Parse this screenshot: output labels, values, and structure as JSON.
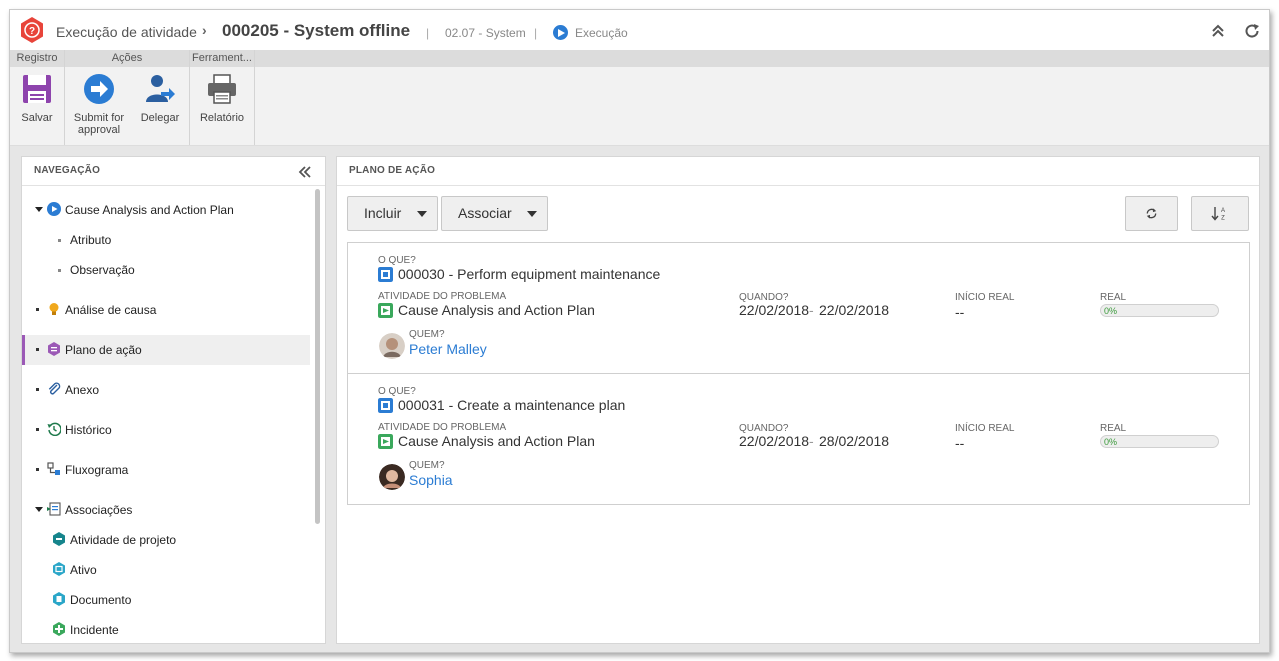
{
  "header": {
    "app_name": "Execução de atividade",
    "record_title": "000205 - System offline",
    "category": "02.07 - System",
    "status": "Execução"
  },
  "ribbon": {
    "groups": [
      "Registro",
      "Ações",
      "Ferrament..."
    ],
    "buttons": {
      "save": "Salvar",
      "submit_line1": "Submit for",
      "submit_line2": "approval",
      "delegate": "Delegar",
      "report": "Relatório"
    }
  },
  "navigation": {
    "title": "NAVEGAÇÃO",
    "items": [
      {
        "label": "Cause Analysis and Action Plan"
      },
      {
        "label": "Atributo"
      },
      {
        "label": "Observação"
      },
      {
        "label": "Análise de causa"
      },
      {
        "label": "Plano de ação"
      },
      {
        "label": "Anexo"
      },
      {
        "label": "Histórico"
      },
      {
        "label": "Fluxograma"
      },
      {
        "label": "Associações"
      },
      {
        "label": "Atividade de projeto"
      },
      {
        "label": "Ativo"
      },
      {
        "label": "Documento"
      },
      {
        "label": "Incidente"
      }
    ]
  },
  "action_plan": {
    "title": "PLANO DE AÇÃO",
    "include_label": "Incluir",
    "associate_label": "Associar",
    "labels": {
      "what": "O QUE?",
      "problem_activity": "ATIVIDADE DO PROBLEMA",
      "when": "QUANDO?",
      "actual_start": "INÍCIO REAL",
      "actual": "REAL",
      "who": "QUEM?",
      "date_sep": "-"
    },
    "items": [
      {
        "what": "000030 - Perform equipment maintenance",
        "problem_activity": "Cause Analysis and Action Plan",
        "when_start": "22/02/2018",
        "when_end": "22/02/2018",
        "actual_start": "--",
        "progress_text": "0%",
        "progress": 0,
        "who": "Peter Malley"
      },
      {
        "what": "000031 - Create a maintenance plan",
        "problem_activity": "Cause Analysis and Action Plan",
        "when_start": "22/02/2018",
        "when_end": "28/02/2018",
        "actual_start": "--",
        "progress_text": "0%",
        "progress": 0,
        "who": "Sophia"
      }
    ]
  },
  "colors": {
    "accent": "#2b7cd3",
    "active_nav": "#9b59b6",
    "app_icon": "#e8443a"
  }
}
